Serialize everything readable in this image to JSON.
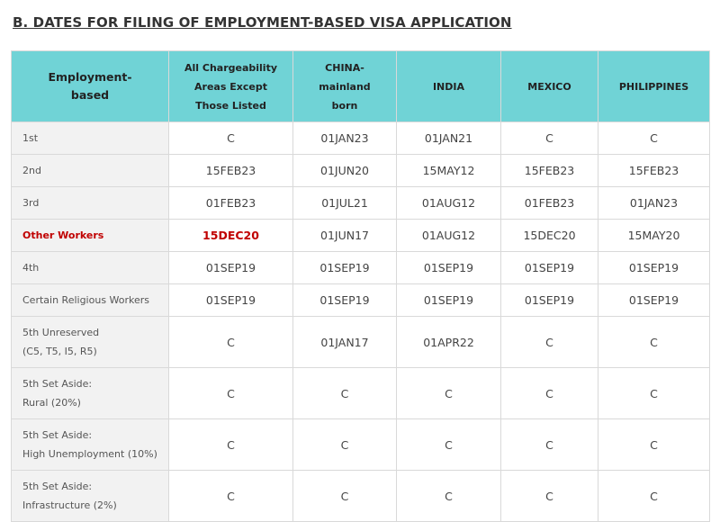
{
  "title": "B. DATES FOR FILING OF EMPLOYMENT-BASED VISA APPLICATION",
  "header": {
    "first": [
      "Employment-",
      "based"
    ],
    "columns": [
      [
        "All Chargeability",
        "Areas Except",
        "Those Listed"
      ],
      [
        "CHINA-",
        "mainland",
        "born"
      ],
      [
        "INDIA"
      ],
      [
        "MEXICO"
      ],
      [
        "PHILIPPINES"
      ]
    ]
  },
  "rows": [
    {
      "label": [
        "1st"
      ],
      "values": [
        "C",
        "01JAN23",
        "01JAN21",
        "C",
        "C"
      ]
    },
    {
      "label": [
        "2nd"
      ],
      "values": [
        "15FEB23",
        "01JUN20",
        "15MAY12",
        "15FEB23",
        "15FEB23"
      ]
    },
    {
      "label": [
        "3rd"
      ],
      "values": [
        "01FEB23",
        "01JUL21",
        "01AUG12",
        "01FEB23",
        "01JAN23"
      ]
    },
    {
      "label": [
        "Other Workers"
      ],
      "values": [
        "15DEC20",
        "01JUN17",
        "01AUG12",
        "15DEC20",
        "15MAY20"
      ]
    },
    {
      "label": [
        "4th"
      ],
      "values": [
        "01SEP19",
        "01SEP19",
        "01SEP19",
        "01SEP19",
        "01SEP19"
      ]
    },
    {
      "label": [
        "Certain Religious Workers"
      ],
      "values": [
        "01SEP19",
        "01SEP19",
        "01SEP19",
        "01SEP19",
        "01SEP19"
      ]
    },
    {
      "label": [
        "5th Unreserved",
        "(C5, T5, I5, R5)"
      ],
      "values": [
        "C",
        "01JAN17",
        "01APR22",
        "C",
        "C"
      ]
    },
    {
      "label": [
        "5th Set Aside:",
        "Rural (20%)"
      ],
      "values": [
        "C",
        "C",
        "C",
        "C",
        "C"
      ]
    },
    {
      "label": [
        "5th Set Aside:",
        "High Unemployment (10%)"
      ],
      "values": [
        "C",
        "C",
        "C",
        "C",
        "C"
      ]
    },
    {
      "label": [
        "5th Set Aside:",
        "Infrastructure (2%)"
      ],
      "values": [
        "C",
        "C",
        "C",
        "C",
        "C"
      ]
    }
  ],
  "highlight_color": "#c00000",
  "header_bg": "#70d3d6"
}
